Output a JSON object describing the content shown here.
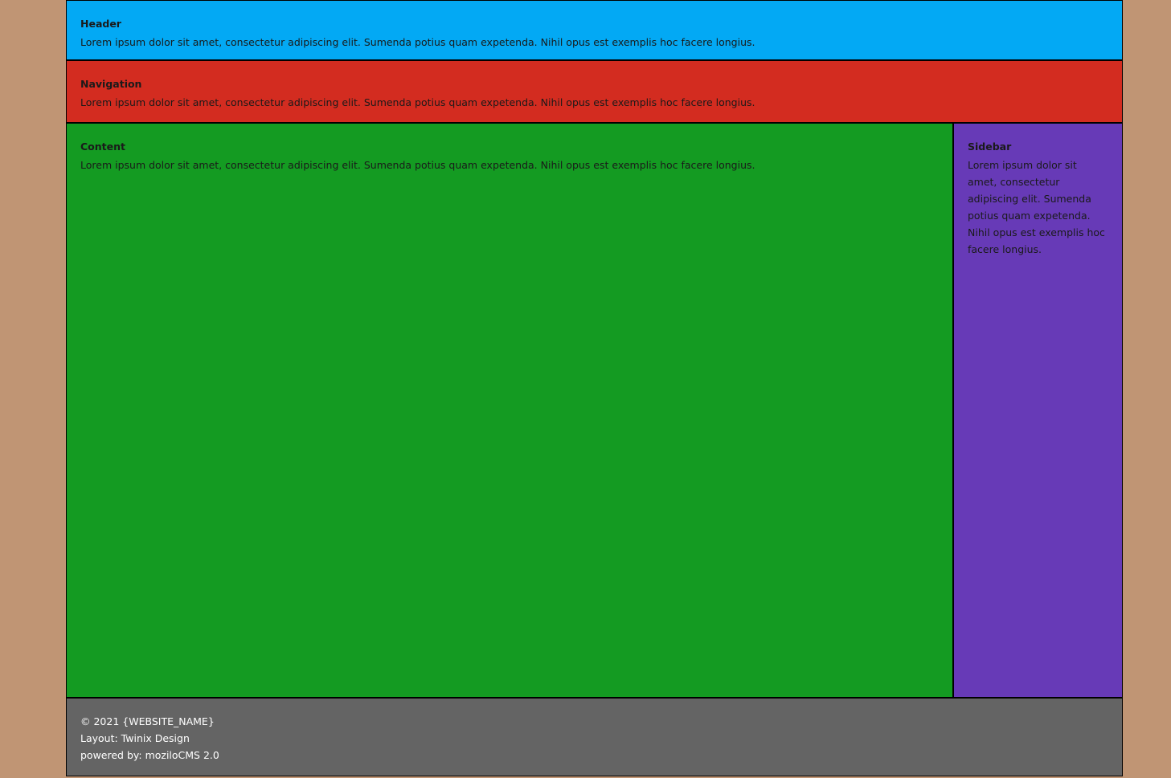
{
  "header": {
    "title": "Header",
    "text": "Lorem ipsum dolor sit amet, consectetur adipiscing elit. Sumenda potius quam expetenda. Nihil opus est exemplis hoc facere longius."
  },
  "navigation": {
    "title": "Navigation",
    "text": "Lorem ipsum dolor sit amet, consectetur adipiscing elit. Sumenda potius quam expetenda. Nihil opus est exemplis hoc facere longius."
  },
  "content": {
    "title": "Content",
    "text": "Lorem ipsum dolor sit amet, consectetur adipiscing elit. Sumenda potius quam expetenda. Nihil opus est exemplis hoc facere longius."
  },
  "sidebar": {
    "title": "Sidebar",
    "text": "Lorem ipsum dolor sit amet, consectetur adipiscing elit. Sumenda potius quam expetenda. Nihil opus est exemplis hoc facere longius."
  },
  "footer": {
    "copyright": "© 2021 {WEBSITE_NAME}",
    "layout": "Layout: Twinix Design",
    "powered": "powered by: moziloCMS 2.0"
  },
  "colors": {
    "page_background": "#c09574",
    "header": "#03a9f4",
    "navigation": "#d32c20",
    "content": "#149b22",
    "sidebar": "#673ab7",
    "footer": "#646464"
  }
}
